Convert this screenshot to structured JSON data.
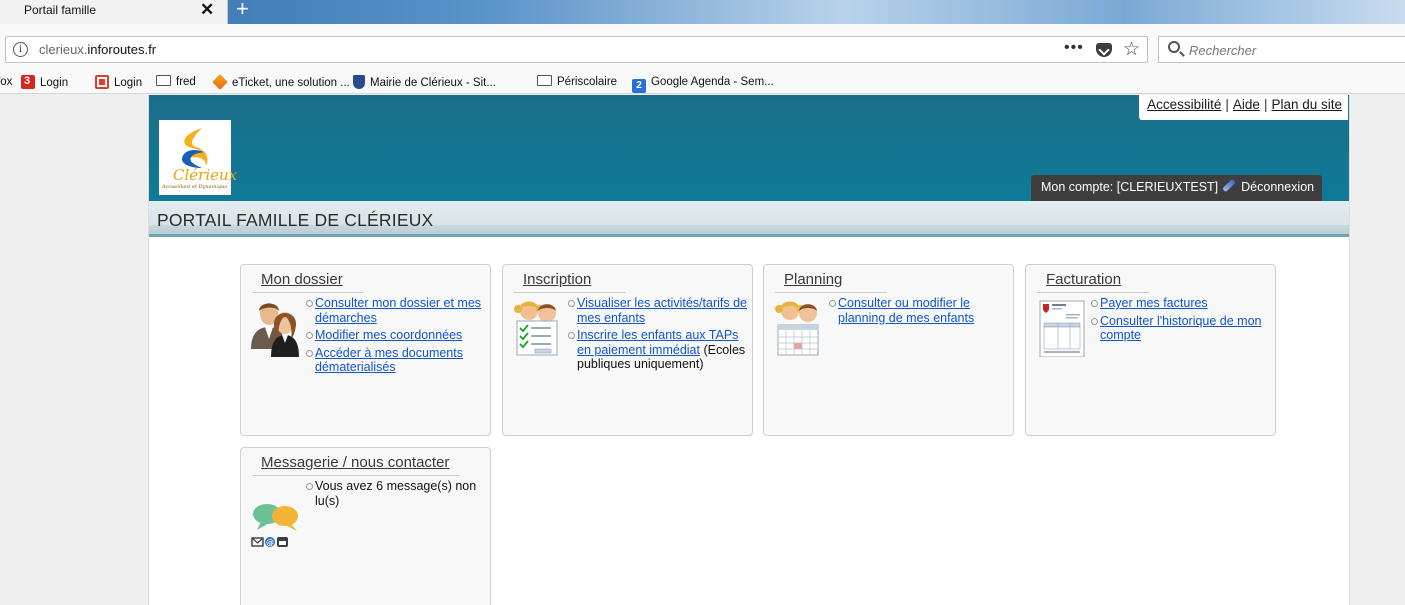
{
  "browser": {
    "tab_title": "Portail famille",
    "tab_close": "✕",
    "new_tab": "+",
    "url_host": "clerieux.",
    "url_domain": "inforoutes.fr",
    "url_menu": "•••",
    "star": "☆",
    "search_placeholder": "Rechercher",
    "bookmarks_overflow": "fox",
    "bookmarks": [
      {
        "label": "Login",
        "icon": "red-square-icon"
      },
      {
        "label": "Login",
        "icon": "red-box-icon"
      },
      {
        "label": "fred",
        "icon": "folder-icon"
      },
      {
        "label": "eTicket, une solution ...",
        "icon": "eticket-icon"
      },
      {
        "label": "Mairie de Clérieux - Sit...",
        "icon": "shield-icon"
      },
      {
        "label": "Périscolaire",
        "icon": "folder-icon"
      },
      {
        "label": "Google Agenda - Sem...",
        "icon": "calendar-icon"
      }
    ],
    "calendar_day": "2"
  },
  "header": {
    "links": [
      "Accessibilité",
      "Aide",
      "Plan du site"
    ],
    "separator": "|",
    "logo_name": "Clérieux",
    "logo_tagline": "Accueillant et Dynamique",
    "account_label": "Mon compte: [CLERIEUXTEST]",
    "logout_label": "Déconnexion"
  },
  "page_title": "PORTAIL FAMILLE DE CLÉRIEUX",
  "cards": {
    "dossier": {
      "title": "Mon dossier",
      "links": [
        "Consulter mon dossier et mes démarches",
        "Modifier mes coordonnées",
        "Accéder à mes documents dématerialisés"
      ]
    },
    "inscription": {
      "title": "Inscription",
      "links": [
        "Visualiser les activités/tarifs de mes enfants",
        "Inscrire les enfants aux TAPs en paiement immédiat"
      ],
      "note": "(Ecoles publiques uniquement)"
    },
    "planning": {
      "title": "Planning",
      "links": [
        "Consulter ou modifier le planning de mes enfants"
      ]
    },
    "facturation": {
      "title": "Facturation",
      "links": [
        "Payer mes factures",
        "Consulter l'historique de mon compte"
      ]
    },
    "messagerie": {
      "title": "Messagerie / nous contacter",
      "message": "Vous avez 6 message(s) non lu(s)"
    }
  }
}
